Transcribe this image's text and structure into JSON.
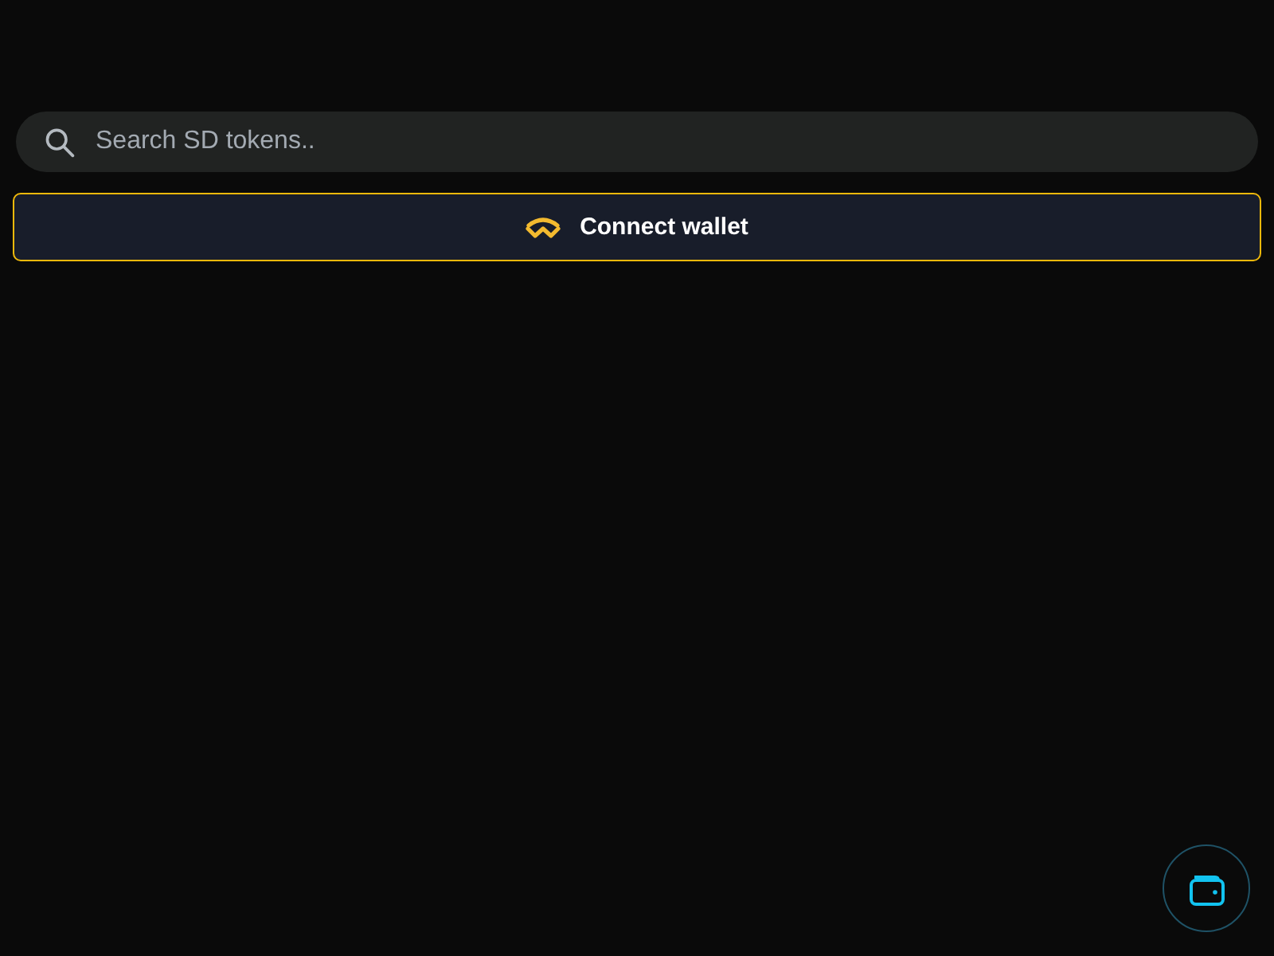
{
  "search": {
    "placeholder": "Search SD tokens.."
  },
  "connect_button": {
    "label": "Connect wallet"
  }
}
